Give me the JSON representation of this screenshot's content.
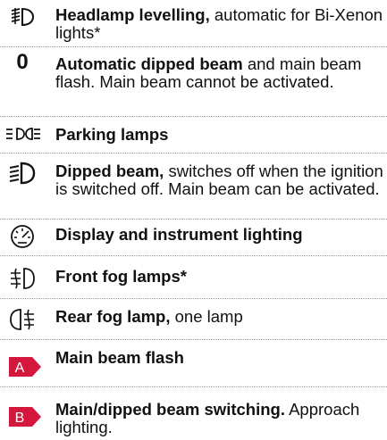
{
  "items": [
    {
      "icon": "headlamp-levelling-icon",
      "bold": "Headlamp levelling,",
      "rest": " automatic for Bi-Xenon lights*"
    },
    {
      "icon": "zero-symbol",
      "symbol": "0",
      "bold": "Automatic dipped beam",
      "rest": " and main beam flash. Main beam cannot be activated."
    },
    {
      "icon": "parking-lamps-icon",
      "bold": "Parking lamps",
      "rest": ""
    },
    {
      "icon": "dipped-beam-icon",
      "bold": "Dipped beam,",
      "rest": " switches off when the ignition is switched off. Main beam can be activated."
    },
    {
      "icon": "instrument-lighting-icon",
      "bold": "Display and instrument lighting",
      "rest": ""
    },
    {
      "icon": "front-fog-lamp-icon",
      "bold": "Front fog lamps*",
      "rest": ""
    },
    {
      "icon": "rear-fog-lamp-icon",
      "bold": "Rear fog lamp,",
      "rest": " one lamp"
    },
    {
      "icon": "badge-a",
      "badge": "A",
      "bold": "Main beam flash",
      "rest": ""
    },
    {
      "icon": "badge-b",
      "badge": "B",
      "bold": "Main/dipped beam switching.",
      "rest": " Approach lighting."
    }
  ],
  "colors": {
    "badge": "#d4183d",
    "text": "#111111",
    "separator": "#9a9a9a"
  }
}
